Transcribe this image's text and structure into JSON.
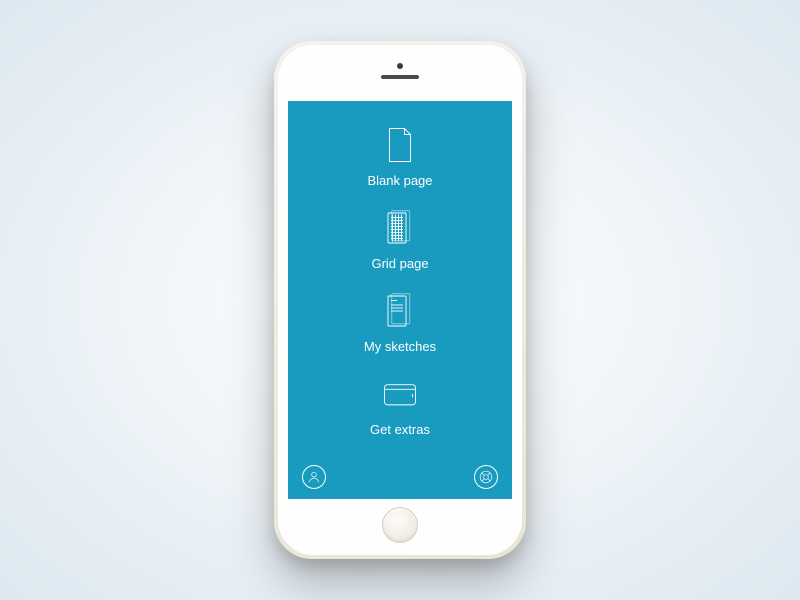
{
  "menu": {
    "items": [
      {
        "icon": "blank-page-icon",
        "label": "Blank page"
      },
      {
        "icon": "grid-page-icon",
        "label": "Grid page"
      },
      {
        "icon": "sketches-icon",
        "label": "My sketches"
      },
      {
        "icon": "extras-icon",
        "label": "Get extras"
      }
    ]
  },
  "footer": {
    "left_icon": "profile-icon",
    "right_icon": "help-icon"
  },
  "colors": {
    "screen_bg": "#189bbf",
    "text": "#ffffff"
  }
}
